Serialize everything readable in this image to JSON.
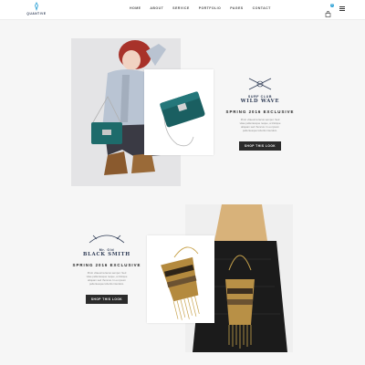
{
  "brand": {
    "logo_text": "QUANTIVE"
  },
  "nav": {
    "items": [
      "HOME",
      "ABOUT",
      "SERVICE",
      "PORTFOLIO",
      "PAGES",
      "CONTACT"
    ]
  },
  "header": {
    "cart_count": "0"
  },
  "section1": {
    "badge_top": "SURF CLUB",
    "badge_bottom": "WILD WAVE",
    "headline": "SPRING 2016 EXCLUSIVE",
    "description": [
      "Proin vitaeurna lacus semper. Sed",
      "vitae pellentesque neque, a tristique",
      "aliquam sed rhoncus. In eu ipsum",
      "pellentesque lobortis interdum."
    ],
    "button": "SHOP THIS LOOK"
  },
  "section2": {
    "badge_top": "Mr. Old",
    "badge_bottom": "BLACK SMITH",
    "headline": "SPRING 2016 EXCLUSIVE",
    "description": [
      "Proin vitaeurna lacus semper. Sed",
      "vitae pellentesque neque, a tristique",
      "aliquam sed rhoncus. In eu ipsum",
      "pellentesque lobortis interdum."
    ],
    "button": "SHOP THIS LOOK"
  },
  "colors": {
    "accent": "#2e3b55",
    "button_bg": "#2b2b2b",
    "teal_bag": "#1d6b6b"
  }
}
